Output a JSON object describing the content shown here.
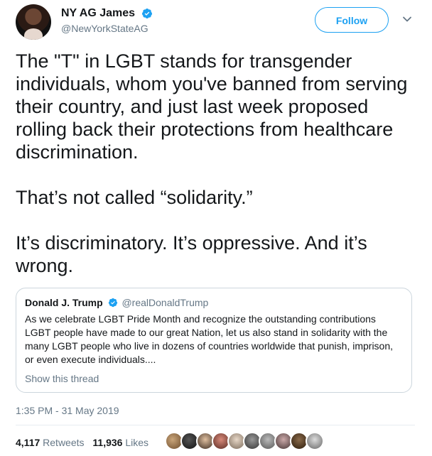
{
  "user": {
    "name": "NY AG James",
    "handle": "@NewYorkStateAG",
    "follow_label": "Follow"
  },
  "tweet": {
    "text": "The \"T\" in LGBT stands for transgender individuals, whom you've banned from serving their country, and just last week proposed rolling back their protections from healthcare discrimination.\n\nThat’s not called “solidarity.”\n\nIt’s discriminatory. It’s oppressive. And it’s wrong."
  },
  "quote": {
    "name": "Donald J. Trump",
    "handle": "@realDonaldTrump",
    "text": "As we celebrate LGBT Pride Month and recognize the outstanding contributions LGBT people have made to our great Nation, let us also stand in solidarity with the many LGBT people who live in dozens of countries worldwide that punish, imprison, or even execute individuals....",
    "show_thread": "Show this thread"
  },
  "timestamp": "1:35 PM - 31 May 2019",
  "stats": {
    "retweets_count": "4,117",
    "retweets_label": "Retweets",
    "likes_count": "11,936",
    "likes_label": "Likes"
  },
  "colors": {
    "accent": "#1da1f2",
    "muted": "#657786",
    "text": "#14171a",
    "border": "#ccd6dd"
  },
  "icons": {
    "verified": "verified-badge-icon",
    "chevron": "chevron-down-icon"
  }
}
